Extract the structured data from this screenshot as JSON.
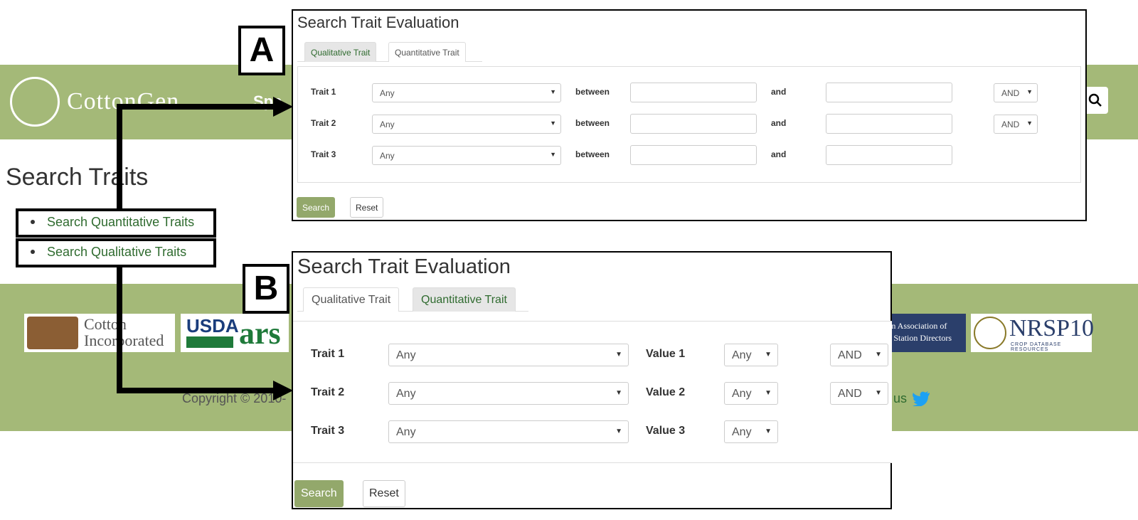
{
  "background": {
    "logo_text": "CottonGen",
    "nav_fragment": "Spe",
    "page_title": "Search Traits",
    "links": [
      {
        "label": "Search Quantitative Traits"
      },
      {
        "label": "Search Qualitative Traits"
      }
    ],
    "footer": {
      "copyright": "Copyright © 2010-",
      "contact_fragment": "us",
      "logos": {
        "cotton_incorporated": "Cotton Incorporated",
        "cotton_mark": "cotton",
        "usda": "USDA",
        "ars": "ars",
        "saaes_line1": "ern Association of",
        "saaes_line2": "nt Station Directors",
        "nrsp": "NRSP10",
        "nrsp_sub": "CROP DATABASE RESOURCES"
      }
    }
  },
  "labels": {
    "A": "A",
    "B": "B"
  },
  "panelA": {
    "title": "Search Trait Evaluation",
    "tabs": [
      {
        "label": "Qualitative Trait",
        "active": false
      },
      {
        "label": "Quantitative Trait",
        "active": true
      }
    ],
    "rows": [
      {
        "label": "Trait 1",
        "select": "Any",
        "between": "between",
        "and": "and",
        "op": "AND"
      },
      {
        "label": "Trait 2",
        "select": "Any",
        "between": "between",
        "and": "and",
        "op": "AND"
      },
      {
        "label": "Trait 3",
        "select": "Any",
        "between": "between",
        "and": "and"
      }
    ],
    "search_button": "Search",
    "reset_button": "Reset"
  },
  "panelB": {
    "title": "Search Trait Evaluation",
    "tabs": [
      {
        "label": "Qualitative Trait",
        "active": true
      },
      {
        "label": "Quantitative Trait",
        "active": false
      }
    ],
    "rows": [
      {
        "label": "Trait 1",
        "select": "Any",
        "value_label": "Value 1",
        "value": "Any",
        "op": "AND"
      },
      {
        "label": "Trait 2",
        "select": "Any",
        "value_label": "Value 2",
        "value": "Any",
        "op": "AND"
      },
      {
        "label": "Trait 3",
        "select": "Any",
        "value_label": "Value 3",
        "value": "Any"
      }
    ],
    "search_button": "Search",
    "reset_button": "Reset"
  },
  "colors": {
    "site_green": "#a4b978",
    "button_green": "#93a86b",
    "link_green": "#2f6b2f"
  }
}
